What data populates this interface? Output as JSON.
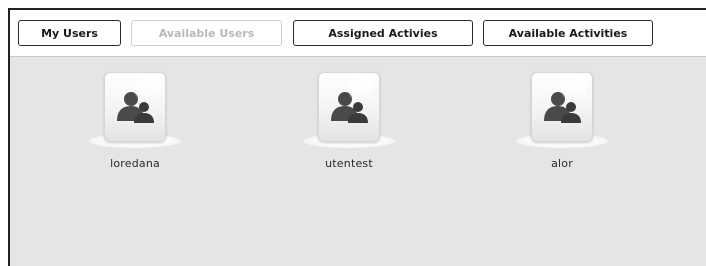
{
  "toolbar": {
    "buttons": [
      {
        "label": "My Users",
        "disabled": false
      },
      {
        "label": "Available Users",
        "disabled": true
      },
      {
        "label": "Assigned Activies",
        "disabled": false
      },
      {
        "label": "Available Activities",
        "disabled": false
      }
    ]
  },
  "users": [
    {
      "name": "loredana",
      "icon": "user-group-icon"
    },
    {
      "name": "utentest",
      "icon": "user-group-icon"
    },
    {
      "name": "alor",
      "icon": "user-group-icon"
    }
  ],
  "colors": {
    "background": "#e5e5e5",
    "toolbar_bg": "#ffffff",
    "button_border": "#2b2b2b",
    "disabled_text": "#b8b8b8",
    "icon_silhouette": "#4a4a4a"
  }
}
